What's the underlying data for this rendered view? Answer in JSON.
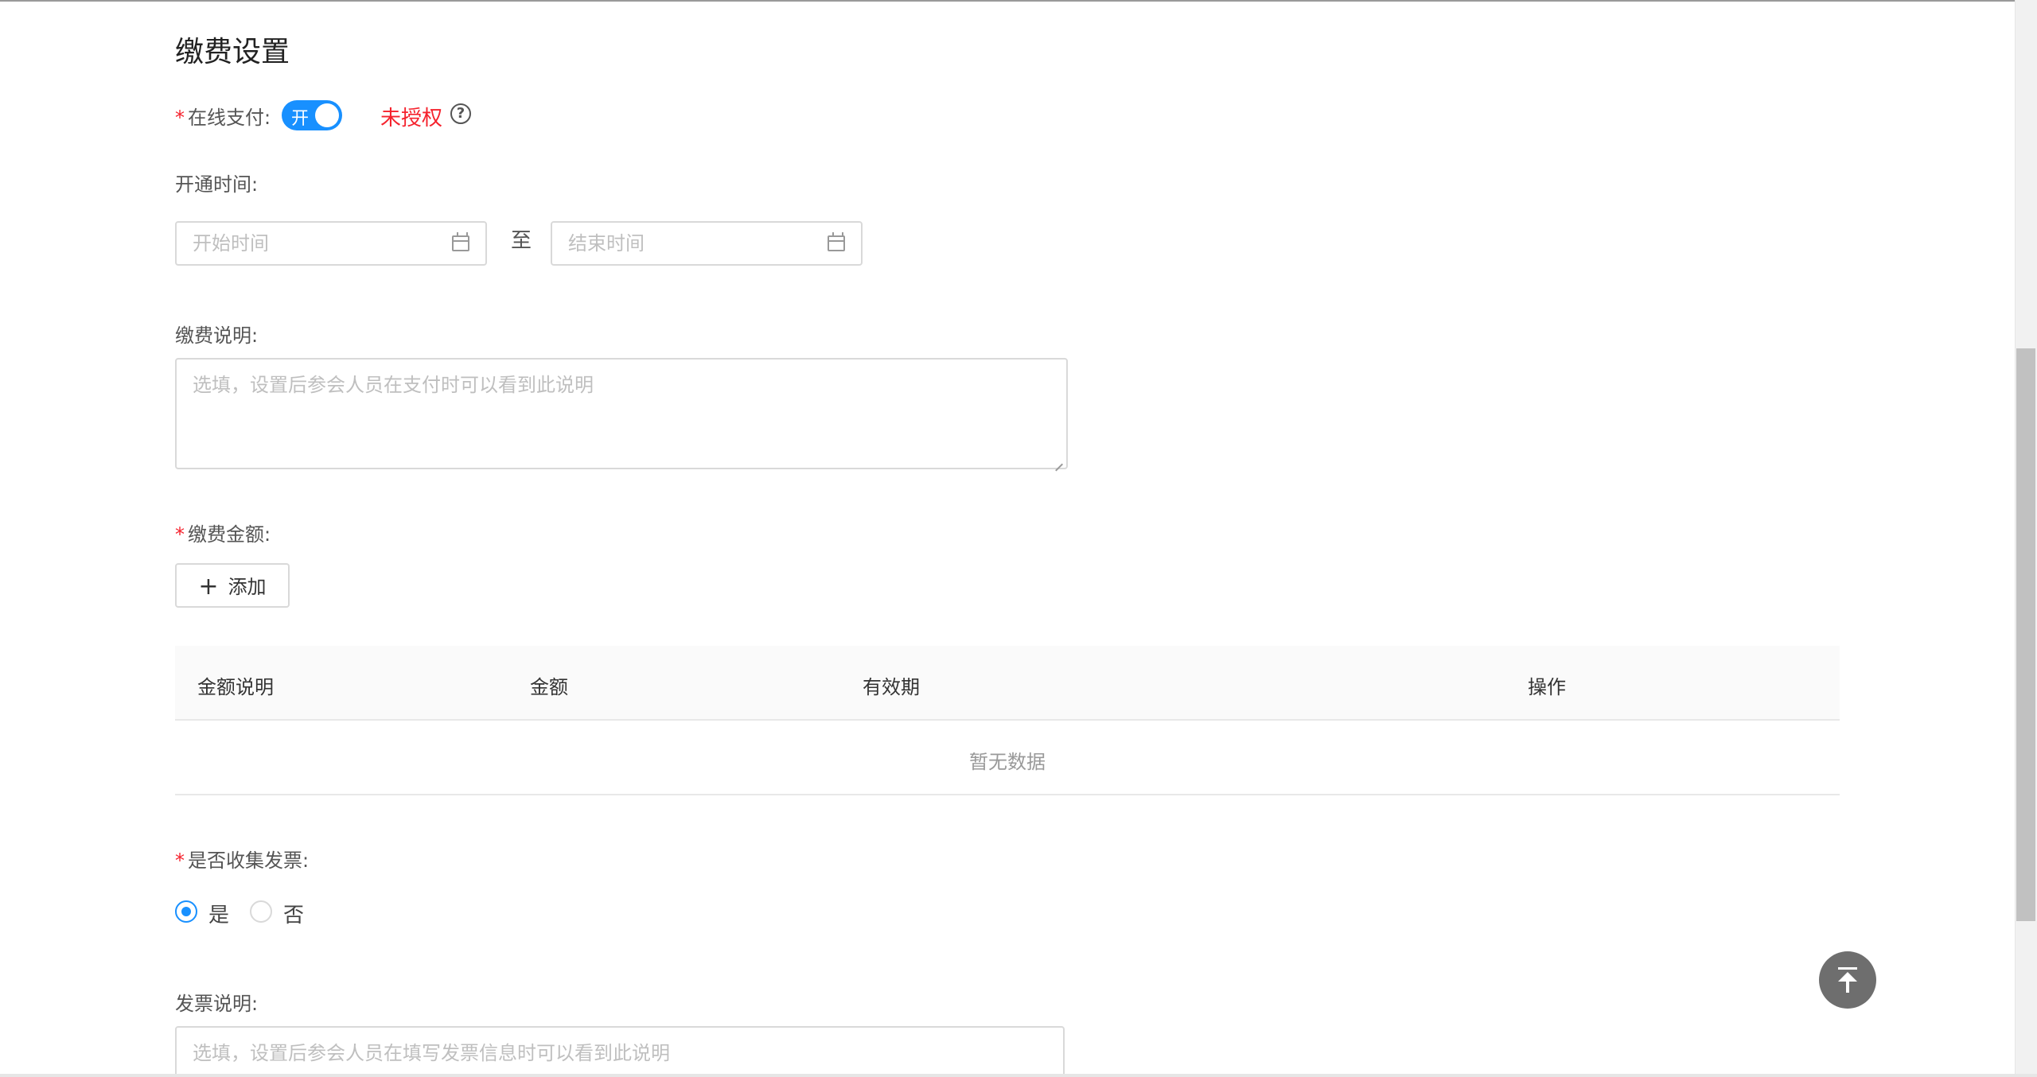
{
  "section_title": "缴费设置",
  "online_payment": {
    "required_mark": "*",
    "label": "在线支付:",
    "toggle_text": "开",
    "toggle_on": true,
    "status": "未授权",
    "help_icon": "question-circle-icon"
  },
  "open_time": {
    "label": "开通时间:",
    "start_placeholder": "开始时间",
    "separator": "至",
    "end_placeholder": "结束时间",
    "icon": "calendar-icon"
  },
  "payment_desc": {
    "label": "缴费说明:",
    "placeholder": "选填，设置后参会人员在支付时可以看到此说明"
  },
  "payment_amount": {
    "required_mark": "*",
    "label": "缴费金额:",
    "add_button": "添加",
    "add_icon": "plus-icon"
  },
  "table": {
    "columns": [
      "金额说明",
      "金额",
      "有效期",
      "操作"
    ],
    "empty_text": "暂无数据"
  },
  "invoice_collect": {
    "required_mark": "*",
    "label": "是否收集发票:",
    "options": [
      "是",
      "否"
    ],
    "selected": "是"
  },
  "invoice_desc": {
    "label": "发票说明:",
    "placeholder": "选填，设置后参会人员在填写发票信息时可以看到此说明"
  },
  "colors": {
    "primary": "#1890ff",
    "danger": "#f5222d"
  }
}
